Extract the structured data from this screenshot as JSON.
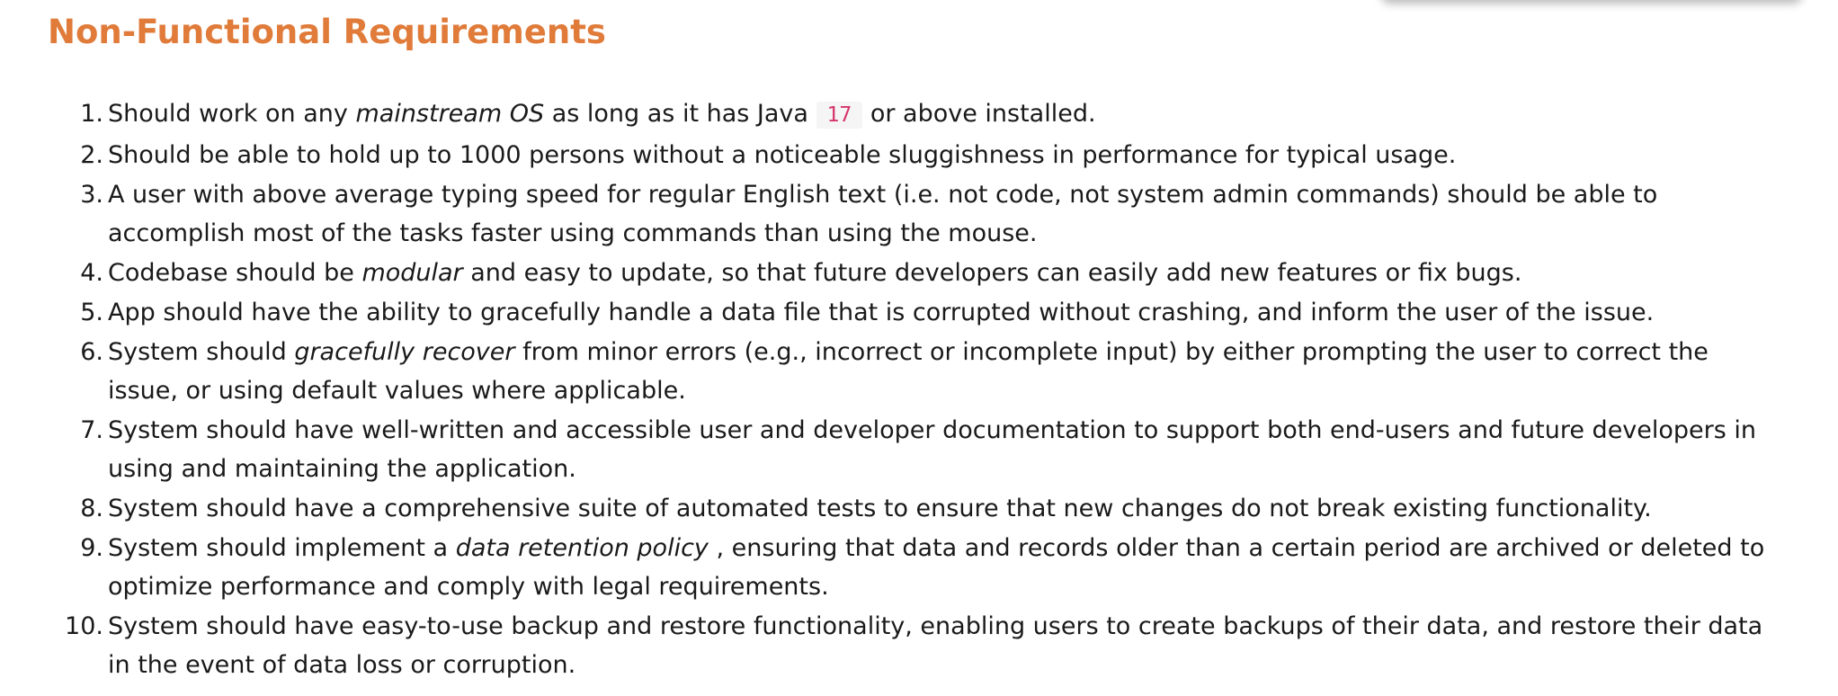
{
  "heading": "Non-Functional Requirements",
  "requirements": [
    {
      "num": "1.",
      "a": "Should work on any ",
      "em": "mainstream OS",
      "b": " as long as it has Java ",
      "code": "17",
      "c": " or above installed."
    },
    {
      "num": "2.",
      "text": "Should be able to hold up to 1000 persons without a noticeable sluggishness in performance for typical usage."
    },
    {
      "num": "3.",
      "text": "A user with above average typing speed for regular English text (i.e. not code, not system admin commands) should be able to accomplish most of the tasks faster using commands than using the mouse."
    },
    {
      "num": "4.",
      "a": "Codebase should be ",
      "em": "modular",
      "b": " and easy to update, so that future developers can easily add new features or fix bugs."
    },
    {
      "num": "5.",
      "text": "App should have the ability to gracefully handle a data file that is corrupted without crashing, and inform the user of the issue."
    },
    {
      "num": "6.",
      "a": "System should ",
      "em": "gracefully recover",
      "b": " from minor errors (e.g., incorrect or incomplete input) by either prompting the user to correct the issue, or using default values where applicable."
    },
    {
      "num": "7.",
      "text": "System should have well-written and accessible user and developer documentation to support both end-users and future developers in using and maintaining the application."
    },
    {
      "num": "8.",
      "text": "System should have a comprehensive suite of automated tests to ensure that new changes do not break existing functionality."
    },
    {
      "num": "9.",
      "a": "System should implement a ",
      "em": "data retention policy",
      "b": " , ensuring that data and records older than a certain period are archived or deleted to optimize performance and comply with legal requirements."
    },
    {
      "num": "10.",
      "text": "System should have easy-to-use backup and restore functionality, enabling users to create backups of their data, and restore their data in the event of data loss or corruption."
    }
  ]
}
